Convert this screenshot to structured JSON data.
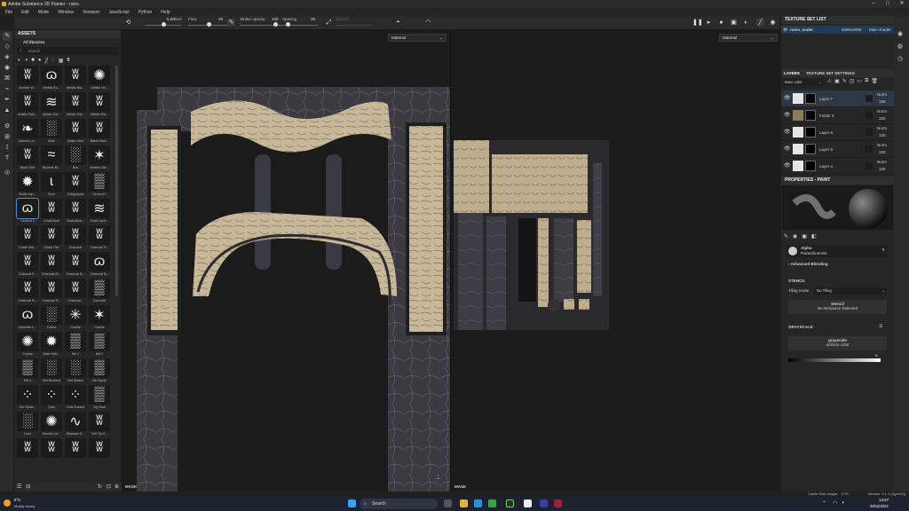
{
  "window": {
    "title": "Adobe Substance 3D Painter - ruins"
  },
  "menu": [
    "File",
    "Edit",
    "Mode",
    "Window",
    "Viewport",
    "JavaScript",
    "Python",
    "Help"
  ],
  "toolbar": {
    "size_label": "Size",
    "size_value": "5.00",
    "flow_label": "Flow",
    "flow_value": "49",
    "stroke_opacity_label": "Stroke opacity",
    "stroke_opacity_value": "100",
    "spacing_label": "Spacing",
    "spacing_value": "25",
    "jitter_label": "Jittered"
  },
  "assets": {
    "title": "ASSETS",
    "library": "All libraries",
    "search_placeholder": "Search",
    "items": [
      "Archive W...",
      "Artistic Bo...",
      "Artistic Bru...",
      "Artistic He...",
      "Artistic Pain...",
      "Artistic Sof...",
      "Artistic Sof...",
      "Artistic Sof...",
      "Autumn Le...",
      "Bark",
      "Basic Hard",
      "Basic Hard...",
      "Basic Soft",
      "Bismuth Bl...",
      "Blur",
      "Broken Gla...",
      "Bullet Imp...",
      "Burn",
      "Calligraphic",
      "Cement 1",
      "Cement 2",
      "Chalk Bold",
      "Chalk Bum...",
      "Chalk Spre...",
      "Chalk Stro...",
      "Chalk Thin",
      "Charcoal",
      "Charcoal Fi...",
      "Charcoal F...",
      "Charcoal Gr...",
      "Charcoal N...",
      "Charcoal N...",
      "Charcoal N...",
      "Charcoal Sl...",
      "Charcoal...",
      "Concrete",
      "Concrete L...",
      "Cotton",
      "Cracks",
      "Cracks",
      "Crystal",
      "Dark Hole...",
      "Dirt 1",
      "Dirt 2",
      "Dirt 3",
      "Dirt Brushed",
      "Dirt Splash",
      "Dirt Spots",
      "Dirt Spots...",
      "Dots",
      "Dots Erased",
      "Dry Mud",
      "Dust",
      "Electric Lin...",
      "Elephant S...",
      "Felt Tip S...",
      "",
      "",
      "",
      ""
    ],
    "selected_index": 20
  },
  "viewport": {
    "left_dropdown": "Material",
    "right_dropdown": "Material",
    "mask_label": "MASK"
  },
  "texture_set_list": {
    "title": "TEXTURE SET LIST",
    "name": "ruins_under",
    "resolution": "4096x4096",
    "shader": "Main shader"
  },
  "layers": {
    "tab1": "LAYERS",
    "tab2": "TEXTURE SET SETTINGS",
    "channel": "Base color",
    "rows": [
      {
        "name": "Layer 7",
        "blend": "Norm",
        "opacity": "100"
      },
      {
        "name": "Folder 3",
        "blend": "Norm",
        "opacity": "100"
      },
      {
        "name": "Layer 6",
        "blend": "Norm",
        "opacity": "100"
      },
      {
        "name": "Layer 5",
        "blend": "Norm",
        "opacity": "100"
      },
      {
        "name": "Layer 4",
        "blend": "Norm",
        "opacity": "100"
      }
    ]
  },
  "properties": {
    "title": "PROPERTIES - PAINT",
    "alpha_label": "Alpha",
    "alpha_value": "PainterlineH04",
    "advanced": "Advanced Blending",
    "stencil_title": "STENCIL",
    "tiling_label": "Tiling mode",
    "tiling_value": "No Tiling",
    "stencil_btn": "Stencil",
    "stencil_sub": "No Resource Selected",
    "grayscale_title": "GRAYSCALE",
    "gray_btn": "grayscale",
    "gray_sub": "uniform color",
    "b_label": "B"
  },
  "status": {
    "cache": "Cache Disk Usage:",
    "cache_val": "27%",
    "version": "Version: 9.1.1 (2(pret3))"
  },
  "taskbar": {
    "temp": "6°C",
    "weather": "Mostly sunny",
    "search": "Search",
    "time": "13:57",
    "date": "28/11/2024"
  }
}
